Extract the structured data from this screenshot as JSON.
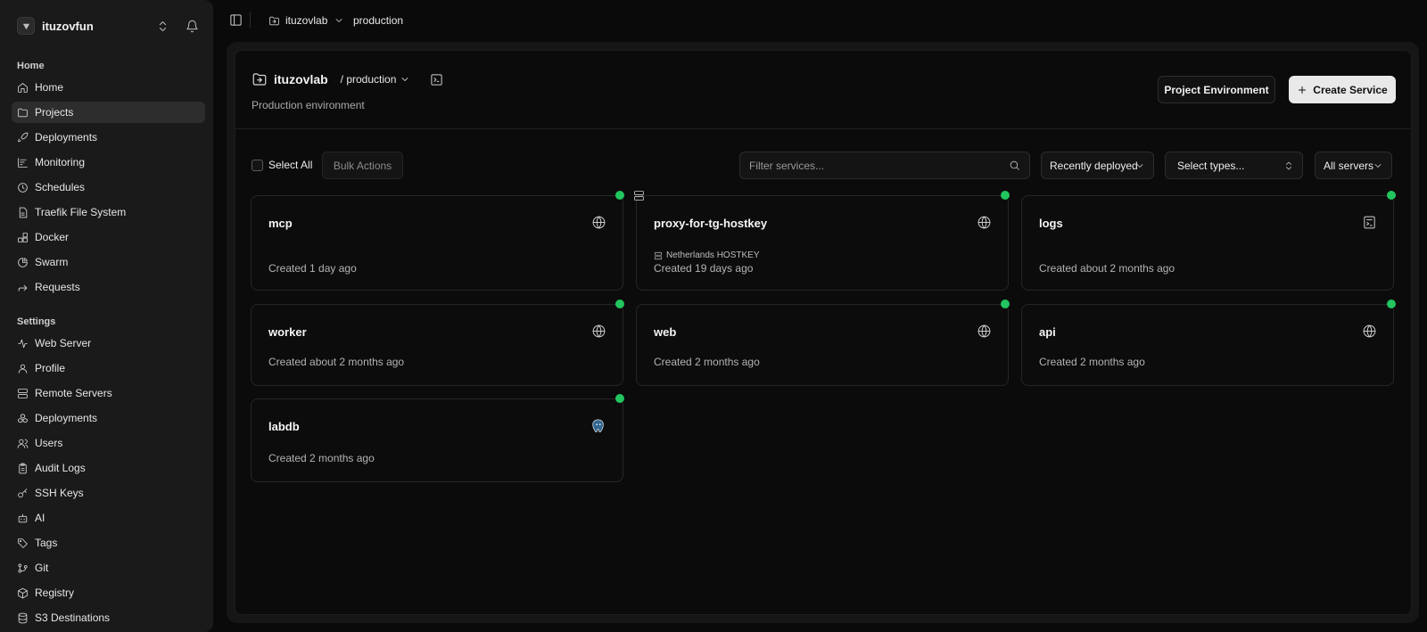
{
  "sidebar": {
    "org_name": "ituzovfun",
    "home_section": "Home",
    "home_items": [
      {
        "label": "Home",
        "icon": "home-icon"
      },
      {
        "label": "Projects",
        "icon": "folder-icon",
        "active": true
      },
      {
        "label": "Deployments",
        "icon": "rocket-icon"
      },
      {
        "label": "Monitoring",
        "icon": "chart-icon"
      },
      {
        "label": "Schedules",
        "icon": "clock-icon"
      },
      {
        "label": "Traefik File System",
        "icon": "file-icon"
      },
      {
        "label": "Docker",
        "icon": "blocks-icon"
      },
      {
        "label": "Swarm",
        "icon": "pie-icon"
      },
      {
        "label": "Requests",
        "icon": "forward-icon"
      }
    ],
    "settings_section": "Settings",
    "settings_items": [
      {
        "label": "Web Server",
        "icon": "activity-icon"
      },
      {
        "label": "Profile",
        "icon": "user-icon"
      },
      {
        "label": "Remote Servers",
        "icon": "server-icon"
      },
      {
        "label": "Deployments",
        "icon": "boxes-icon"
      },
      {
        "label": "Users",
        "icon": "users-icon"
      },
      {
        "label": "Audit Logs",
        "icon": "clipboard-icon"
      },
      {
        "label": "SSH Keys",
        "icon": "key-icon"
      },
      {
        "label": "AI",
        "icon": "bot-icon"
      },
      {
        "label": "Tags",
        "icon": "tag-icon"
      },
      {
        "label": "Git",
        "icon": "git-icon"
      },
      {
        "label": "Registry",
        "icon": "package-icon"
      },
      {
        "label": "S3 Destinations",
        "icon": "database-icon"
      }
    ]
  },
  "breadcrumb": {
    "project": "ituzovlab",
    "environment": "production"
  },
  "header": {
    "project_title": "ituzovlab",
    "environment_label": "/ production",
    "subtitle": "Production environment",
    "project_env_button": "Project Environment",
    "create_service_button": "Create Service"
  },
  "toolbar": {
    "select_all": "Select All",
    "bulk_actions": "Bulk Actions",
    "filter_placeholder": "Filter services...",
    "sort_value": "Recently deployed",
    "types_value": "Select types...",
    "servers_value": "All servers"
  },
  "services": [
    {
      "name": "mcp",
      "created": "Created 1 day ago",
      "icon": "globe-icon",
      "status_color": "#22c55e"
    },
    {
      "name": "proxy-for-tg-hostkey",
      "created": "Created 19 days ago",
      "server": "Netherlands HOSTKEY",
      "icon": "globe-icon",
      "status_color": "#22c55e"
    },
    {
      "name": "logs",
      "created": "Created about 2 months ago",
      "icon": "compose-icon",
      "status_color": "#22c55e"
    },
    {
      "name": "worker",
      "created": "Created about 2 months ago",
      "icon": "globe-icon",
      "status_color": "#22c55e"
    },
    {
      "name": "web",
      "created": "Created 2 months ago",
      "icon": "globe-icon",
      "status_color": "#22c55e"
    },
    {
      "name": "api",
      "created": "Created 2 months ago",
      "icon": "globe-icon",
      "status_color": "#22c55e"
    },
    {
      "name": "labdb",
      "created": "Created 2 months ago",
      "icon": "postgres-icon",
      "status_color": "#22c55e"
    }
  ]
}
